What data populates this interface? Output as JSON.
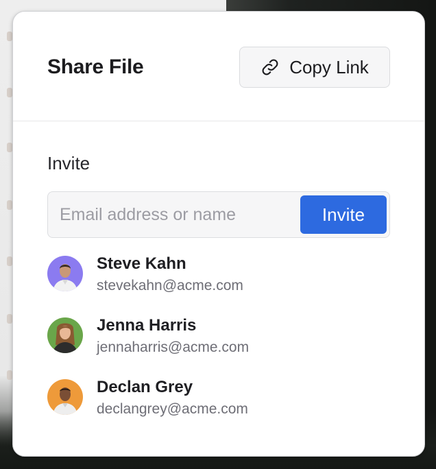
{
  "dialog": {
    "title": "Share File",
    "copy_link_label": "Copy Link"
  },
  "invite": {
    "label": "Invite",
    "input_placeholder": "Email address or name",
    "input_value": "",
    "button_label": "Invite"
  },
  "people": [
    {
      "name": "Steve Kahn",
      "email": "stevekahn@acme.com",
      "avatar_color": "#8b7bf0",
      "icon": "avatar"
    },
    {
      "name": "Jenna Harris",
      "email": "jennaharris@acme.com",
      "avatar_color": "#6aa64a",
      "icon": "avatar"
    },
    {
      "name": "Declan Grey",
      "email": "declangrey@acme.com",
      "avatar_color": "#ee9a3a",
      "icon": "avatar"
    }
  ],
  "colors": {
    "accent": "#2d6ae0",
    "title_text": "#1c1c1f",
    "secondary_text": "#6e6e76"
  }
}
